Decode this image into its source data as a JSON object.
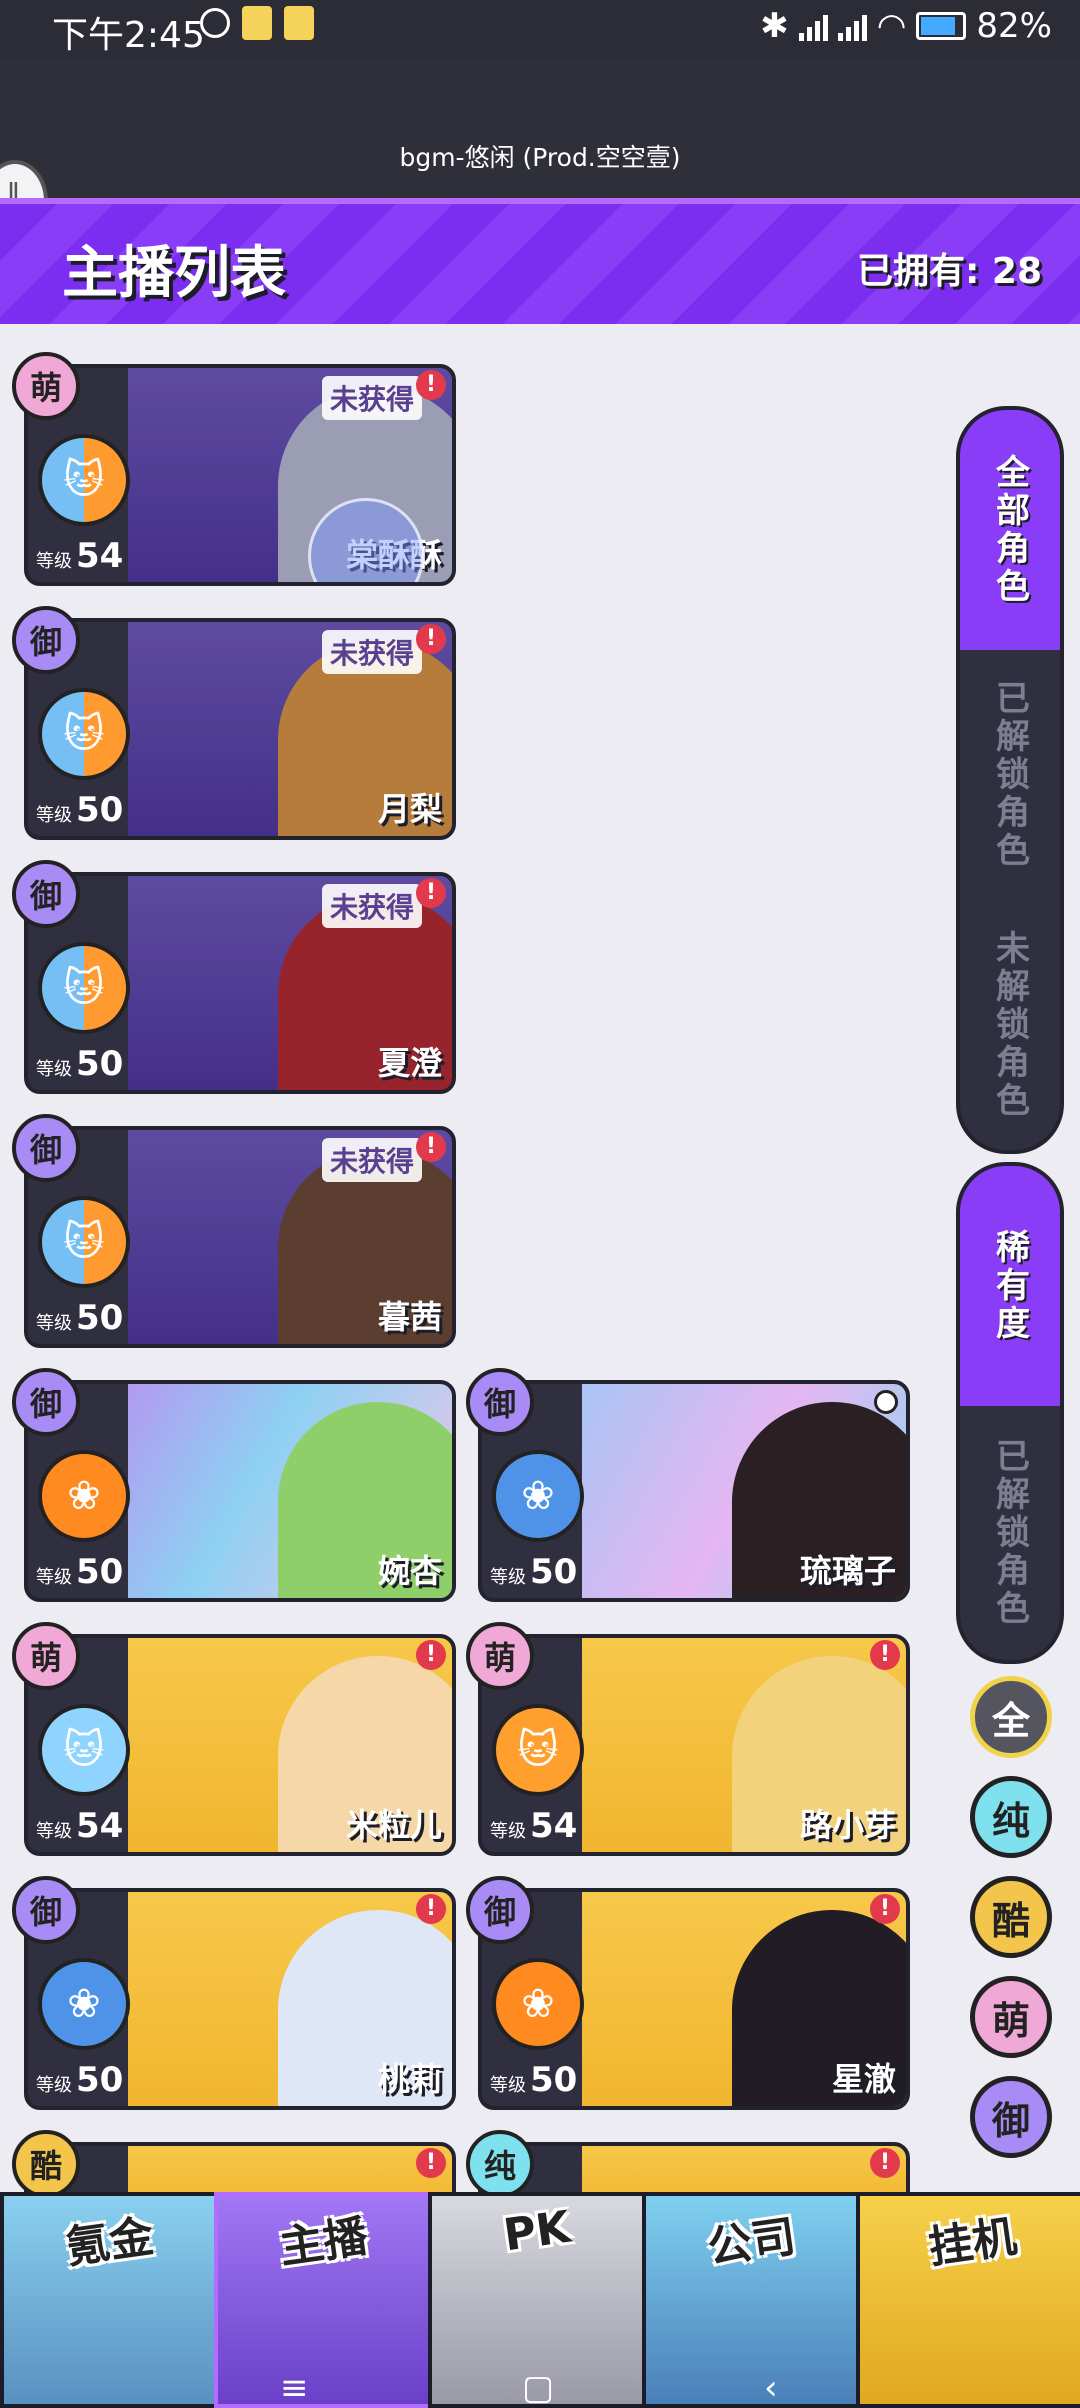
{
  "status_bar": {
    "time": "下午2:45",
    "battery": "82%"
  },
  "music": {
    "title": "bgm-悠闲 (Prod.空空壹)"
  },
  "header": {
    "title": "主播列表",
    "owned_label": "已拥有: 28"
  },
  "cards": [
    {
      "type_badge": "萌",
      "level_label": "等级",
      "level": "54",
      "name": "棠酥酥",
      "status": "未获得",
      "alert": "!"
    },
    {
      "type_badge": "御",
      "level_label": "等级",
      "level": "50",
      "name": "月梨",
      "status": "未获得",
      "alert": "!"
    },
    {
      "type_badge": "御",
      "level_label": "等级",
      "level": "50",
      "name": "夏澄",
      "status": "未获得",
      "alert": "!"
    },
    {
      "type_badge": "御",
      "level_label": "等级",
      "level": "50",
      "name": "暮茜",
      "status": "未获得",
      "alert": "!"
    },
    {
      "type_badge": "御",
      "level_label": "等级",
      "level": "50",
      "name": "婉杏",
      "status": "",
      "alert": ""
    },
    {
      "type_badge": "御",
      "level_label": "等级",
      "level": "50",
      "name": "琉璃子",
      "status": "",
      "alert": ""
    },
    {
      "type_badge": "萌",
      "level_label": "等级",
      "level": "54",
      "name": "米粒儿",
      "status": "",
      "alert": "!"
    },
    {
      "type_badge": "萌",
      "level_label": "等级",
      "level": "54",
      "name": "路小芽",
      "status": "",
      "alert": "!"
    },
    {
      "type_badge": "御",
      "level_label": "等级",
      "level": "50",
      "name": "桃莉",
      "status": "",
      "alert": "!"
    },
    {
      "type_badge": "御",
      "level_label": "等级",
      "level": "50",
      "name": "星澈",
      "status": "",
      "alert": "!"
    },
    {
      "type_badge": "酷",
      "alert": "!"
    },
    {
      "type_badge": "纯",
      "alert": "!"
    }
  ],
  "filters": {
    "group1": [
      "全部角色",
      "已解锁角色",
      "未解锁角色"
    ],
    "group2": [
      "稀有度",
      "已解锁角色"
    ],
    "type_buttons": [
      "全",
      "纯",
      "酷",
      "萌",
      "御"
    ]
  },
  "bottom_nav": [
    "氪金",
    "主播",
    "PK",
    "公司",
    "挂机"
  ],
  "colors": {
    "accent": "#8a3df6",
    "header": "#7b2df0",
    "background": "#ececf2",
    "card_dark": "#2f2f3f"
  }
}
